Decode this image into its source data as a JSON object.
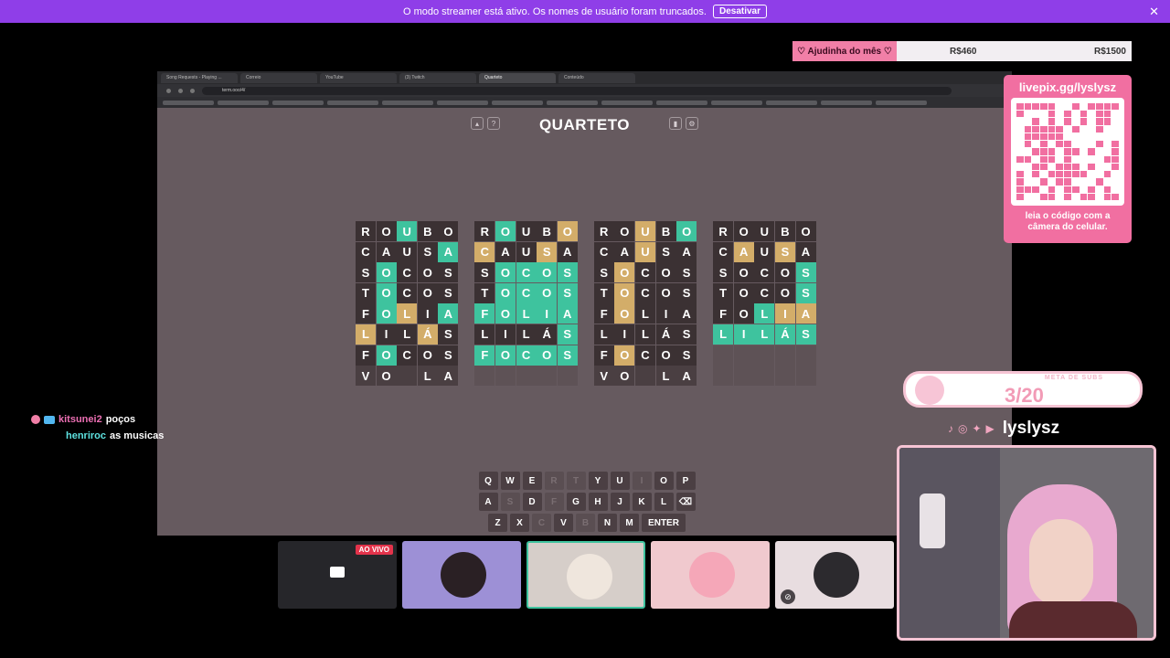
{
  "banner": {
    "message": "O modo streamer está ativo. Os nomes de usuário foram truncados.",
    "button": "Desativar",
    "close": "✕"
  },
  "goal": {
    "label": "♡ Ajudinha do mês ♡",
    "current": "R$460",
    "target": "R$1500"
  },
  "browser": {
    "tabs": [
      "Song Requests - Playing ...",
      "Correio",
      "YouTube",
      "(3) Twitch",
      "Quarteto",
      "Conteúdo"
    ],
    "active_tab": 4,
    "url": "term.ooo/4/"
  },
  "game": {
    "title": "QUARTETO",
    "help": "?",
    "boards": [
      {
        "rows": [
          [
            "R",
            "",
            "O",
            "",
            "U",
            "g",
            "B",
            "",
            "O",
            ""
          ],
          [
            "C",
            "",
            "A",
            "",
            "U",
            "",
            "S",
            "",
            "A",
            "g"
          ],
          [
            "S",
            "",
            "O",
            "g",
            "C",
            "",
            "O",
            "",
            "S",
            ""
          ],
          [
            "T",
            "",
            "O",
            "g",
            "C",
            "",
            "O",
            "",
            "S",
            ""
          ],
          [
            "F",
            "",
            "O",
            "g",
            "L",
            "y",
            "I",
            "",
            "A",
            "g"
          ],
          [
            "L",
            "y",
            "I",
            "",
            "L",
            "",
            "Á",
            "y",
            "S",
            ""
          ],
          [
            "F",
            "",
            "O",
            "g",
            "C",
            "",
            "O",
            "",
            "S",
            ""
          ],
          [
            "V",
            "cur",
            "O",
            "cur",
            "",
            "cur",
            "L",
            "cur",
            "A",
            "cur"
          ]
        ]
      },
      {
        "rows": [
          [
            "R",
            "",
            "O",
            "g",
            "U",
            "",
            "B",
            "",
            "O",
            "y"
          ],
          [
            "C",
            "y",
            "A",
            "",
            "U",
            "",
            "S",
            "y",
            "A",
            ""
          ],
          [
            "S",
            "",
            "O",
            "g",
            "C",
            "g",
            "O",
            "g",
            "S",
            "g"
          ],
          [
            "T",
            "",
            "O",
            "g",
            "C",
            "g",
            "O",
            "g",
            "S",
            "g"
          ],
          [
            "F",
            "g",
            "O",
            "g",
            "L",
            "g",
            "I",
            "g",
            "A",
            "g"
          ],
          [
            "L",
            "",
            "I",
            "",
            "L",
            "",
            "Á",
            "",
            "S",
            "g"
          ],
          [
            "F",
            "g",
            "O",
            "g",
            "C",
            "g",
            "O",
            "g",
            "S",
            "g"
          ],
          [
            "",
            "e",
            "",
            "e",
            "",
            "e",
            "",
            "e",
            "",
            "e"
          ]
        ]
      },
      {
        "rows": [
          [
            "R",
            "",
            "O",
            "",
            "U",
            "y",
            "B",
            "",
            "O",
            "g"
          ],
          [
            "C",
            "",
            "A",
            "",
            "U",
            "y",
            "S",
            "",
            "A",
            ""
          ],
          [
            "S",
            "",
            "O",
            "y",
            "C",
            "",
            "O",
            "",
            "S",
            ""
          ],
          [
            "T",
            "",
            "O",
            "y",
            "C",
            "",
            "O",
            "",
            "S",
            ""
          ],
          [
            "F",
            "",
            "O",
            "y",
            "L",
            "",
            "I",
            "",
            "A",
            ""
          ],
          [
            "L",
            "",
            "I",
            "",
            "L",
            "",
            "Á",
            "",
            "S",
            ""
          ],
          [
            "F",
            "",
            "O",
            "y",
            "C",
            "",
            "O",
            "",
            "S",
            ""
          ],
          [
            "V",
            "cur",
            "O",
            "cur",
            "",
            "cur",
            "L",
            "cur",
            "A",
            "cur"
          ]
        ]
      },
      {
        "rows": [
          [
            "R",
            "",
            "O",
            "",
            "U",
            "",
            "B",
            "",
            "O",
            ""
          ],
          [
            "C",
            "",
            "A",
            "y",
            "U",
            "",
            "S",
            "y",
            "A",
            ""
          ],
          [
            "S",
            "",
            "O",
            "",
            "C",
            "",
            "O",
            "",
            "S",
            "g"
          ],
          [
            "T",
            "",
            "O",
            "",
            "C",
            "",
            "O",
            "",
            "S",
            "g"
          ],
          [
            "F",
            "",
            "O",
            "",
            "L",
            "g",
            "I",
            "y",
            "A",
            "y"
          ],
          [
            "L",
            "g",
            "I",
            "g",
            "L",
            "g",
            "Á",
            "g",
            "S",
            "g"
          ],
          [
            "",
            "e",
            "",
            "e",
            "",
            "e",
            "",
            "e",
            "",
            "e"
          ],
          [
            "",
            "e",
            "",
            "e",
            "",
            "e",
            "",
            "e",
            "",
            "e"
          ]
        ]
      }
    ],
    "keyboard": {
      "row1": [
        "Q",
        "W",
        "E",
        "R",
        "T",
        "Y",
        "U",
        "I",
        "O",
        "P"
      ],
      "row2": [
        "A",
        "S",
        "D",
        "F",
        "G",
        "H",
        "J",
        "K",
        "L",
        "⌫"
      ],
      "row3": [
        "Z",
        "X",
        "C",
        "V",
        "B",
        "N",
        "M"
      ],
      "enter": "ENTER",
      "dim": [
        "R",
        "T",
        "I",
        "S",
        "F",
        "C",
        "B"
      ]
    }
  },
  "qr": {
    "url": "livepix.gg/lyslysz",
    "caption": "leia o código com a câmera do celular."
  },
  "subgoal": {
    "title": "META DE SUBS",
    "value": "3/20"
  },
  "socials": {
    "handle": "lyslysz"
  },
  "chat": [
    {
      "user": "kitsunei2",
      "message": "poços"
    },
    {
      "user": "henriroc",
      "message": "as musicas"
    }
  ],
  "tiles": {
    "live_badge": "AO VIVO"
  },
  "colors": {
    "green": "#3ec39e",
    "yellow": "#d3ad69",
    "accent": "#8f3ee8",
    "pink": "#f16fa1"
  }
}
